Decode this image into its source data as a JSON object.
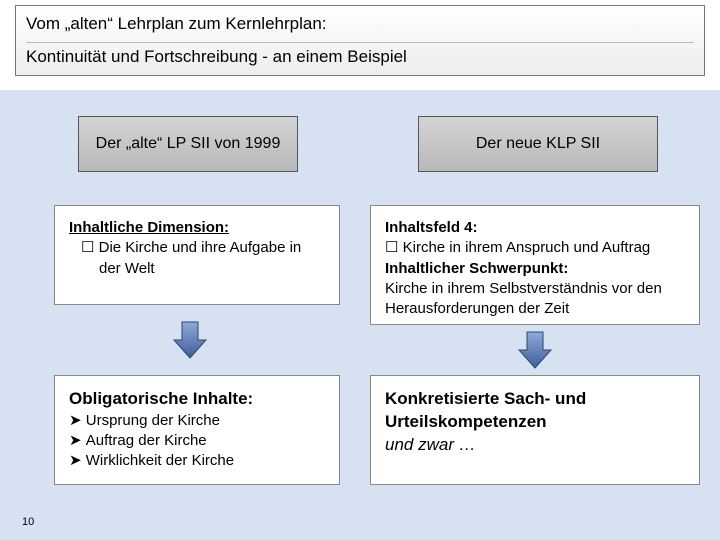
{
  "title": {
    "line1": "Vom „alten“ Lehrplan zum Kernlehrplan:",
    "line2": "Kontinuität und Fortschreibung  -  an einem Beispiel"
  },
  "left": {
    "header": "Der „alte“ LP SII von 1999",
    "box1": {
      "heading": "Inhaltliche Dimension:",
      "item1": "Die Kirche und ihre Aufgabe in der Welt"
    },
    "box2": {
      "heading": "Obligatorische Inhalte:",
      "item1": "Ursprung der Kirche",
      "item2": "Auftrag der Kirche",
      "item3": "Wirklichkeit der Kirche"
    }
  },
  "right": {
    "header": "Der neue KLP SII",
    "box1": {
      "heading1": "Inhaltsfeld 4:",
      "item1": "Kirche in ihrem Anspruch und Auftrag",
      "heading2": "Inhaltlicher Schwerpunkt:",
      "item2": "Kirche in ihrem Selbstverständnis vor den Herausforderungen der Zeit"
    },
    "box2": {
      "heading": "Konkretisierte Sach- und Urteilskompetenzen",
      "tail": "und zwar …"
    }
  },
  "page_number": "10"
}
